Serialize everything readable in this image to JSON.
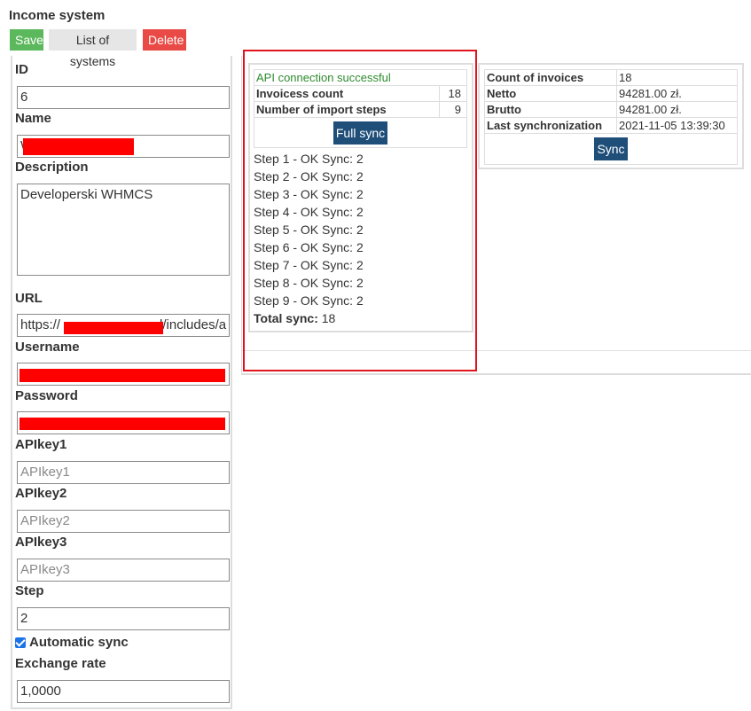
{
  "page": {
    "title": "Income system"
  },
  "toolbar": {
    "save": "Save",
    "list": "List of systems",
    "delete": "Delete"
  },
  "form": {
    "id_label": "ID",
    "id_value": "6",
    "name_label": "Name",
    "name_value": "W",
    "description_label": "Description",
    "description_value": "Developerski WHMCS",
    "url_label": "URL",
    "url_value_start": "https://",
    "url_value_end": "l/includes/a",
    "username_label": "Username",
    "password_label": "Password",
    "apikey1_label": "APIkey1",
    "apikey1_placeholder": "APIkey1",
    "apikey2_label": "APIkey2",
    "apikey2_placeholder": "APIkey2",
    "apikey3_label": "APIkey3",
    "apikey3_placeholder": "APIkey3",
    "step_label": "Step",
    "step_value": "2",
    "auto_sync_label": "Automatic sync",
    "auto_sync_checked": true,
    "exchange_label": "Exchange rate",
    "exchange_value": "1,0000"
  },
  "api_panel": {
    "status": "API connection successful",
    "rows": [
      {
        "label": "Invoicess count",
        "value": "18"
      },
      {
        "label": "Number of import steps",
        "value": "9"
      }
    ],
    "full_sync": "Full sync",
    "steps": [
      "Step 1 - OK Sync: 2",
      "Step 2 - OK Sync: 2",
      "Step 3 - OK Sync: 2",
      "Step 4 - OK Sync: 2",
      "Step 5 - OK Sync: 2",
      "Step 6 - OK Sync: 2",
      "Step 7 - OK Sync: 2",
      "Step 8 - OK Sync: 2",
      "Step 9 - OK Sync: 2"
    ],
    "total_label": "Total sync:",
    "total_value": "18"
  },
  "summary_panel": {
    "rows": [
      {
        "label": "Count of invoices",
        "value": "18"
      },
      {
        "label": "Netto",
        "value": "94281.00 zł."
      },
      {
        "label": "Brutto",
        "value": "94281.00 zł."
      },
      {
        "label": "Last synchronization",
        "value": "2021-11-05 13:39:30"
      }
    ],
    "sync": "Sync"
  },
  "colors": {
    "save": "#5cb85c",
    "delete": "#e94a45",
    "primary": "#1f4e79",
    "success_text": "#2e8b2e",
    "highlight": "#e0141e",
    "redaction": "#ff0000"
  }
}
